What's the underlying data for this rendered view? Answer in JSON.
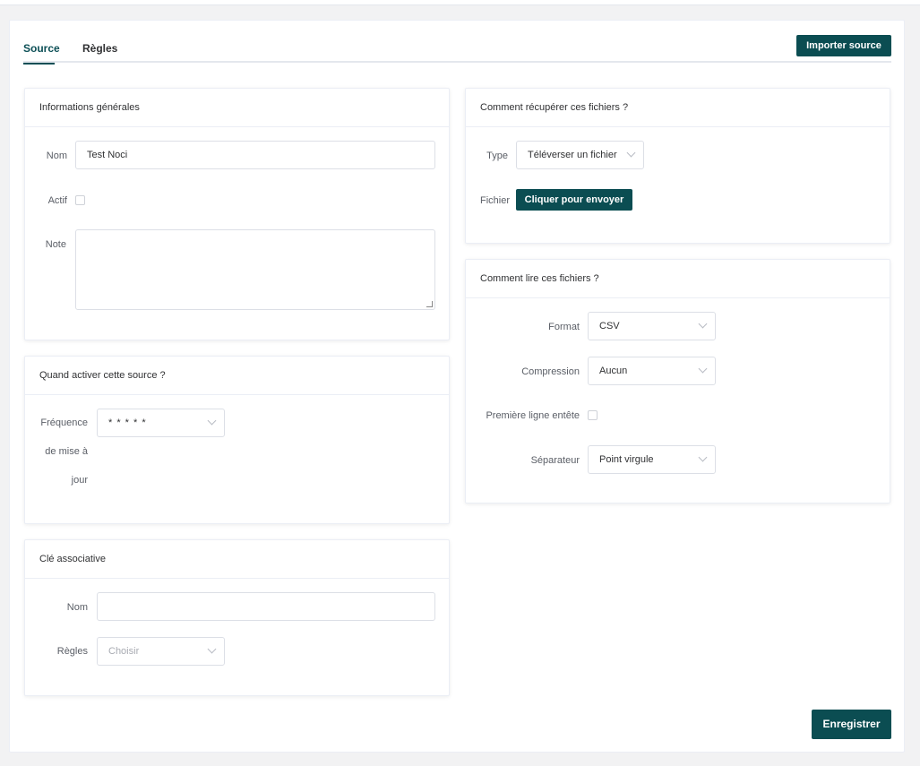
{
  "tabs": [
    {
      "label": "Source",
      "active": true
    },
    {
      "label": "Règles",
      "active": false
    }
  ],
  "actions": {
    "import_label": "Importer source",
    "save_label": "Enregistrer"
  },
  "general_info": {
    "title": "Informations générales",
    "name_label": "Nom",
    "name_value": "Test Noci",
    "active_label": "Actif",
    "active_checked": false,
    "note_label": "Note",
    "note_value": ""
  },
  "schedule": {
    "title": "Quand activer cette source ?",
    "frequency_label_line1": "Fréquence",
    "frequency_label_line2": "de mise à",
    "frequency_label_line3": "jour",
    "frequency_value": "* * * * *"
  },
  "key": {
    "title": "Clé associative",
    "name_label": "Nom",
    "name_value": "",
    "rules_label": "Règles",
    "rules_placeholder": "Choisir"
  },
  "retrieve": {
    "title": "Comment récupérer ces fichiers ?",
    "type_label": "Type",
    "type_value": "Téléverser un fichier",
    "file_label": "Fichier",
    "upload_label": "Cliquer pour envoyer"
  },
  "read": {
    "title": "Comment lire ces fichiers ?",
    "format_label": "Format",
    "format_value": "CSV",
    "compression_label": "Compression",
    "compression_value": "Aucun",
    "header_label": "Première ligne entête",
    "header_checked": false,
    "separator_label": "Séparateur",
    "separator_value": "Point virgule"
  },
  "colors": {
    "accent": "#0b4d52",
    "border": "#dcdfe6",
    "background": "#f2f2f3"
  }
}
